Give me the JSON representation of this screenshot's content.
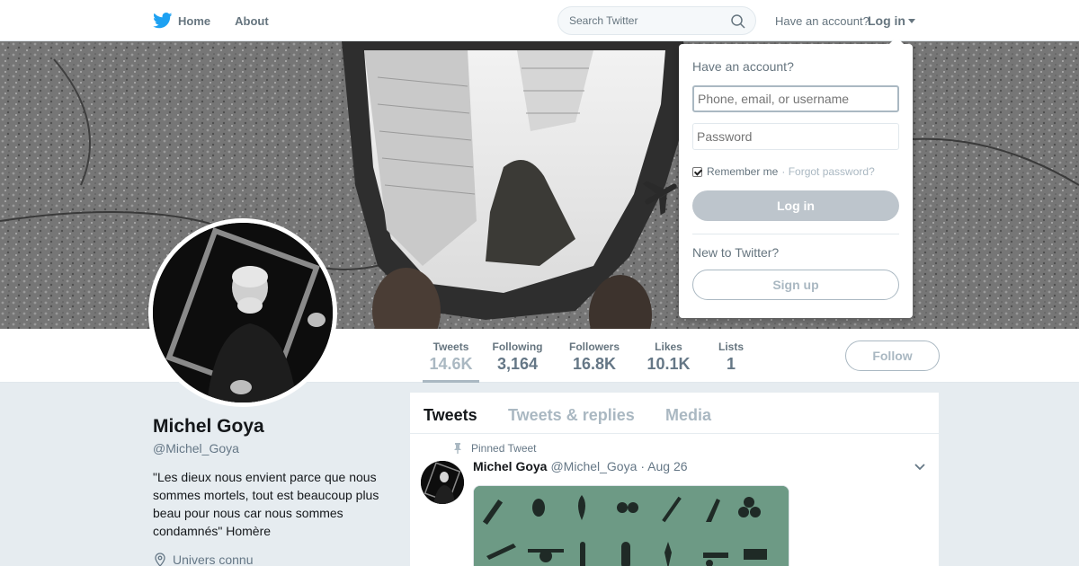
{
  "nav": {
    "home_label": "Home",
    "about_label": "About",
    "search_placeholder": "Search Twitter",
    "have_account": "Have an account?",
    "login_label": "Log in"
  },
  "profile": {
    "name": "Michel Goya",
    "handle": "@Michel_Goya",
    "bio": "\"Les dieux nous envient parce que nous sommes mortels, tout est beaucoup plus beau pour nous car nous sommes condamnés\" Homère",
    "location": "Univers connu"
  },
  "stats": [
    {
      "label": "Tweets",
      "value": "14.6K"
    },
    {
      "label": "Following",
      "value": "3,164"
    },
    {
      "label": "Followers",
      "value": "16.8K"
    },
    {
      "label": "Likes",
      "value": "10.1K"
    },
    {
      "label": "Lists",
      "value": "1"
    }
  ],
  "follow_label": "Follow",
  "timeline": {
    "tabs": [
      "Tweets",
      "Tweets & replies",
      "Media"
    ],
    "pinned_label": "Pinned Tweet",
    "tweet": {
      "name": "Michel Goya",
      "handle": "@Michel_Goya",
      "date": "· Aug 26"
    }
  },
  "login_dropdown": {
    "title": "Have an account?",
    "username_placeholder": "Phone, email, or username",
    "password_placeholder": "Password",
    "remember_label": "Remember me",
    "forgot_label": "· Forgot password?",
    "login_button": "Log in",
    "new_label": "New to Twitter?",
    "signup_button": "Sign up"
  },
  "colors": {
    "twitter_blue": "#1da1f2",
    "muted": "#66757f",
    "disabled_button": "#bdc5cc"
  }
}
